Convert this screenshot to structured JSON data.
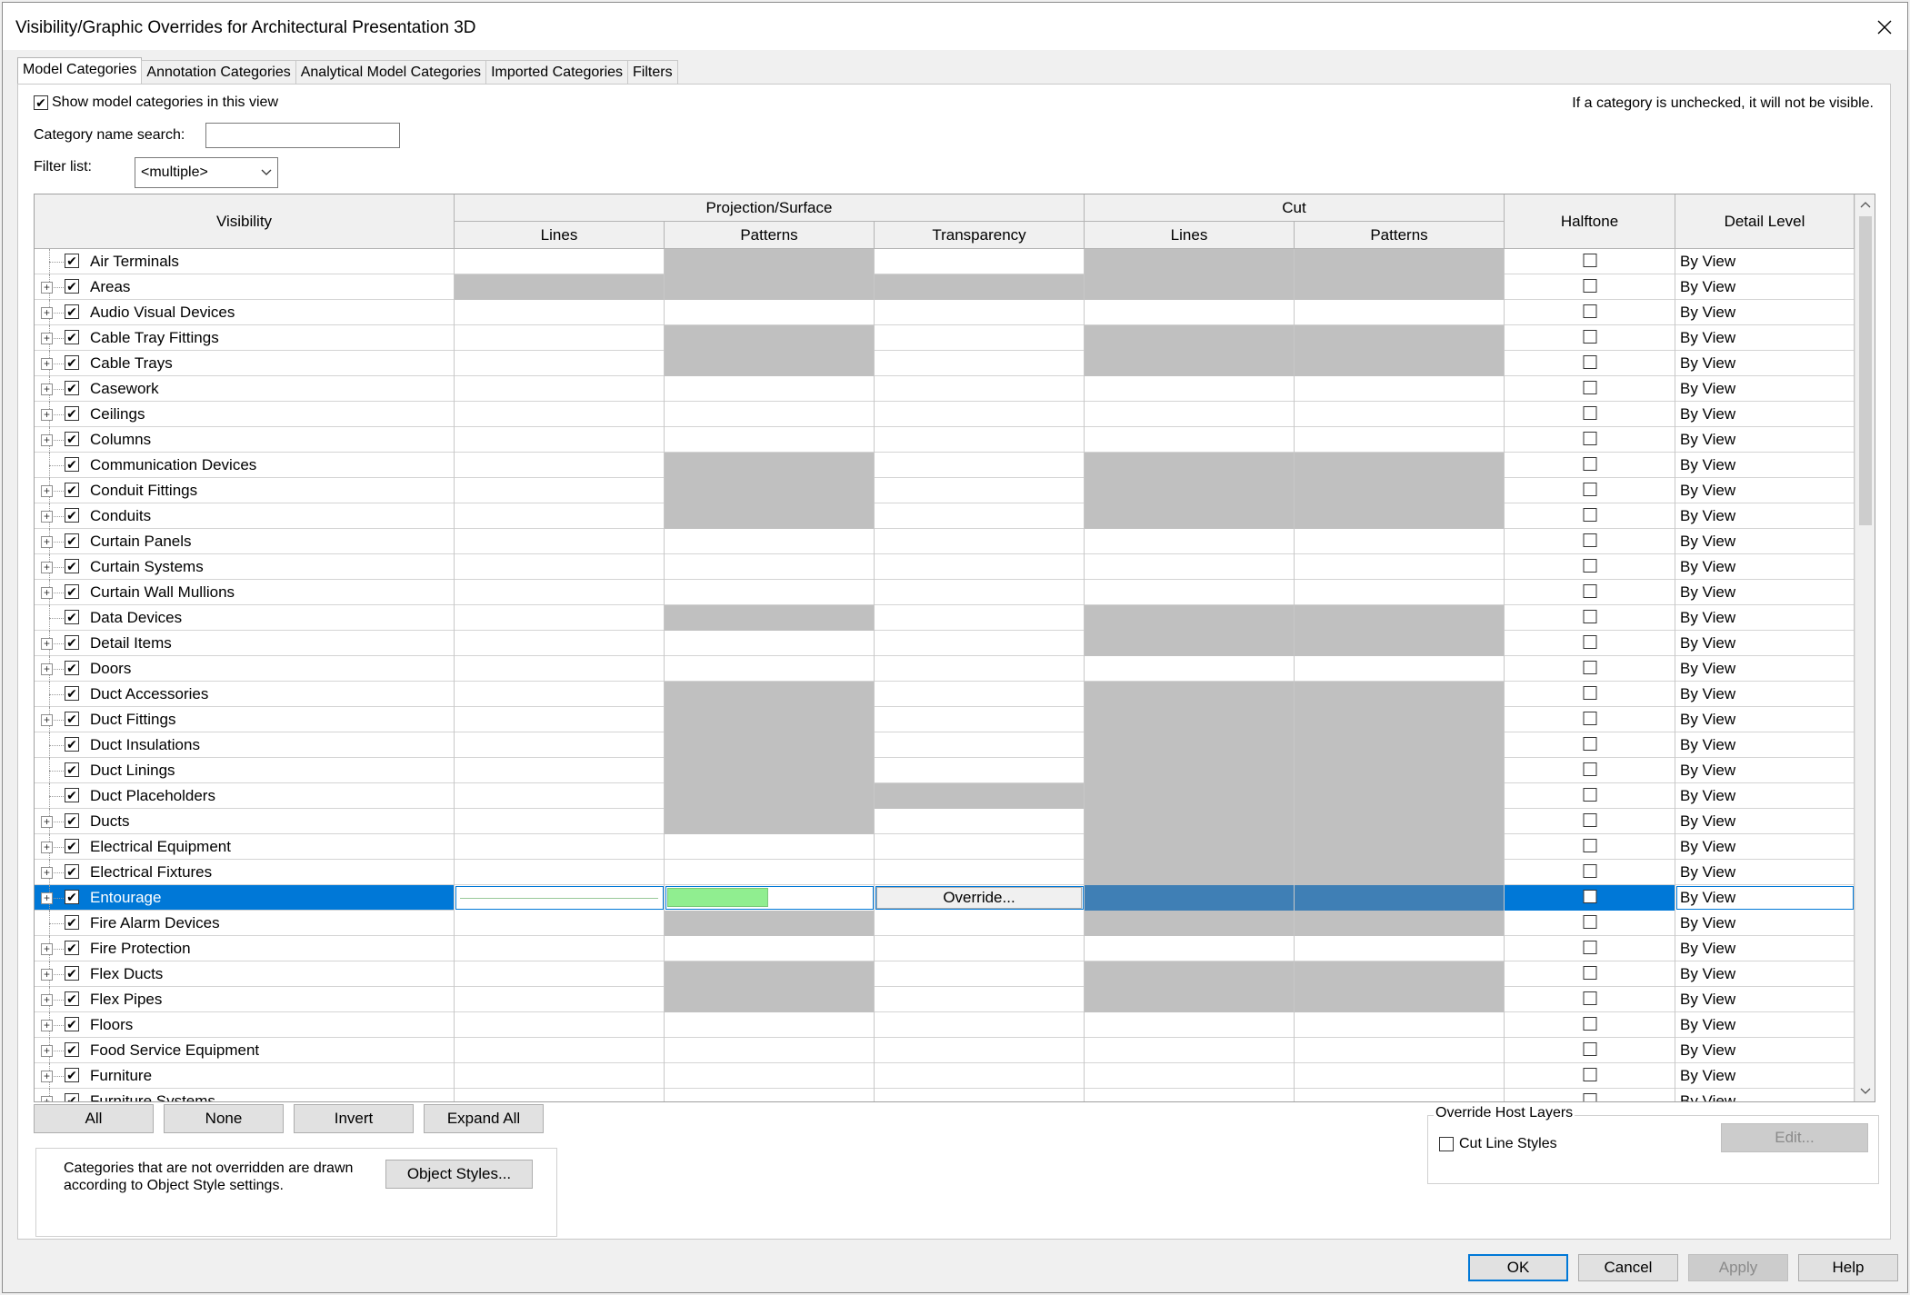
{
  "window": {
    "title": "Visibility/Graphic Overrides for Architectural Presentation 3D"
  },
  "tabs": [
    "Model Categories",
    "Annotation Categories",
    "Analytical Model Categories",
    "Imported Categories",
    "Filters"
  ],
  "top": {
    "show_label": "Show model categories in this view",
    "hint": "If a category is unchecked, it will not be visible.",
    "search_label": "Category name search:",
    "search_value": "",
    "filter_label": "Filter list:",
    "filter_value": "<multiple>"
  },
  "grid": {
    "headers": {
      "visibility": "Visibility",
      "projection": "Projection/Surface",
      "cut": "Cut",
      "lines": "Lines",
      "patterns": "Patterns",
      "transparency": "Transparency",
      "cut_lines": "Lines",
      "cut_patterns": "Patterns",
      "halftone": "Halftone",
      "detail": "Detail Level"
    },
    "override_label": "Override...",
    "rows": [
      {
        "name": "Air Terminals",
        "exp": false,
        "g": [
          0,
          1,
          0,
          1,
          1
        ],
        "d": "By View"
      },
      {
        "name": "Areas",
        "exp": true,
        "g": [
          1,
          1,
          1,
          1,
          1
        ],
        "d": "By View"
      },
      {
        "name": "Audio Visual Devices",
        "exp": true,
        "g": [
          0,
          0,
          0,
          0,
          0
        ],
        "d": "By View"
      },
      {
        "name": "Cable Tray Fittings",
        "exp": true,
        "g": [
          0,
          1,
          0,
          1,
          1
        ],
        "d": "By View"
      },
      {
        "name": "Cable Trays",
        "exp": true,
        "g": [
          0,
          1,
          0,
          1,
          1
        ],
        "d": "By View"
      },
      {
        "name": "Casework",
        "exp": true,
        "g": [
          0,
          0,
          0,
          0,
          0
        ],
        "d": "By View"
      },
      {
        "name": "Ceilings",
        "exp": true,
        "g": [
          0,
          0,
          0,
          0,
          0
        ],
        "d": "By View"
      },
      {
        "name": "Columns",
        "exp": true,
        "g": [
          0,
          0,
          0,
          0,
          0
        ],
        "d": "By View"
      },
      {
        "name": "Communication Devices",
        "exp": false,
        "g": [
          0,
          1,
          0,
          1,
          1
        ],
        "d": "By View"
      },
      {
        "name": "Conduit Fittings",
        "exp": true,
        "g": [
          0,
          1,
          0,
          1,
          1
        ],
        "d": "By View"
      },
      {
        "name": "Conduits",
        "exp": true,
        "g": [
          0,
          1,
          0,
          1,
          1
        ],
        "d": "By View"
      },
      {
        "name": "Curtain Panels",
        "exp": true,
        "g": [
          0,
          0,
          0,
          0,
          0
        ],
        "d": "By View"
      },
      {
        "name": "Curtain Systems",
        "exp": true,
        "g": [
          0,
          0,
          0,
          0,
          0
        ],
        "d": "By View"
      },
      {
        "name": "Curtain Wall Mullions",
        "exp": true,
        "g": [
          0,
          0,
          0,
          0,
          0
        ],
        "d": "By View"
      },
      {
        "name": "Data Devices",
        "exp": false,
        "g": [
          0,
          1,
          0,
          1,
          1
        ],
        "d": "By View"
      },
      {
        "name": "Detail Items",
        "exp": true,
        "g": [
          0,
          0,
          0,
          1,
          1
        ],
        "d": "By View"
      },
      {
        "name": "Doors",
        "exp": true,
        "g": [
          0,
          0,
          0,
          0,
          0
        ],
        "d": "By View"
      },
      {
        "name": "Duct Accessories",
        "exp": false,
        "g": [
          0,
          1,
          0,
          1,
          1
        ],
        "d": "By View"
      },
      {
        "name": "Duct Fittings",
        "exp": true,
        "g": [
          0,
          1,
          0,
          1,
          1
        ],
        "d": "By View"
      },
      {
        "name": "Duct Insulations",
        "exp": false,
        "g": [
          0,
          1,
          0,
          1,
          1
        ],
        "d": "By View"
      },
      {
        "name": "Duct Linings",
        "exp": false,
        "g": [
          0,
          1,
          0,
          1,
          1
        ],
        "d": "By View"
      },
      {
        "name": "Duct Placeholders",
        "exp": false,
        "g": [
          0,
          1,
          1,
          1,
          1
        ],
        "d": "By View"
      },
      {
        "name": "Ducts",
        "exp": true,
        "g": [
          0,
          1,
          0,
          1,
          1
        ],
        "d": "By View"
      },
      {
        "name": "Electrical Equipment",
        "exp": true,
        "g": [
          0,
          0,
          0,
          1,
          1
        ],
        "d": "By View"
      },
      {
        "name": "Electrical Fixtures",
        "exp": true,
        "g": [
          0,
          0,
          0,
          1,
          1
        ],
        "d": "By View"
      },
      {
        "name": "Entourage",
        "exp": true,
        "g": [
          0,
          0,
          0,
          1,
          1
        ],
        "d": "By View",
        "selected": true
      },
      {
        "name": "Fire Alarm Devices",
        "exp": false,
        "g": [
          0,
          1,
          0,
          1,
          1
        ],
        "d": "By View"
      },
      {
        "name": "Fire Protection",
        "exp": true,
        "g": [
          0,
          0,
          0,
          0,
          0
        ],
        "d": "By View"
      },
      {
        "name": "Flex Ducts",
        "exp": true,
        "g": [
          0,
          1,
          0,
          1,
          1
        ],
        "d": "By View"
      },
      {
        "name": "Flex Pipes",
        "exp": true,
        "g": [
          0,
          1,
          0,
          1,
          1
        ],
        "d": "By View"
      },
      {
        "name": "Floors",
        "exp": true,
        "g": [
          0,
          0,
          0,
          0,
          0
        ],
        "d": "By View"
      },
      {
        "name": "Food Service Equipment",
        "exp": true,
        "g": [
          0,
          0,
          0,
          0,
          0
        ],
        "d": "By View"
      },
      {
        "name": "Furniture",
        "exp": true,
        "g": [
          0,
          0,
          0,
          0,
          0
        ],
        "d": "By View"
      },
      {
        "name": "Furniture Systems",
        "exp": true,
        "g": [
          0,
          0,
          0,
          0,
          0
        ],
        "d": "By View"
      }
    ]
  },
  "buttons": {
    "all": "All",
    "none": "None",
    "invert": "Invert",
    "expand_all": "Expand All",
    "object_styles": "Object Styles...",
    "edit": "Edit...",
    "ok": "OK",
    "cancel": "Cancel",
    "apply": "Apply",
    "help": "Help"
  },
  "note": "Categories that are not overridden are drawn according to Object Style settings.",
  "override_host": {
    "title": "Override Host Layers",
    "cut_line_styles": "Cut Line Styles"
  },
  "icons": {
    "close": "close-icon",
    "dropdown": "chevron-down-icon",
    "expand": "plus-box-icon"
  }
}
